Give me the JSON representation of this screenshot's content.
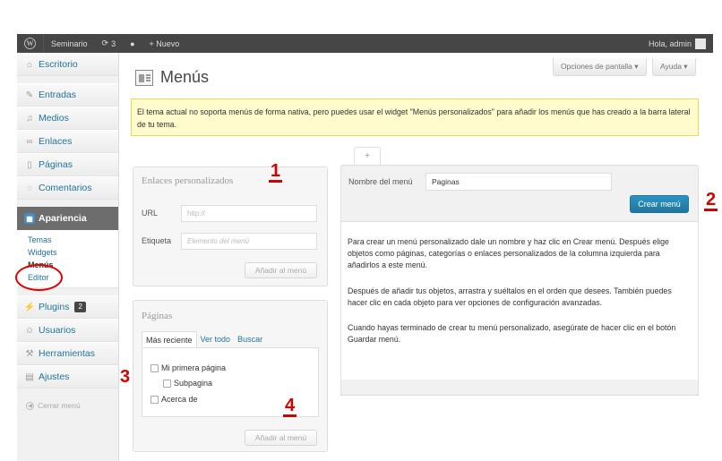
{
  "adminbar": {
    "logo_icon": "wordpress-logo-icon",
    "site_name": "Seminario",
    "updates_count": "3",
    "new_label": "+ Nuevo",
    "greeting": "Hola, admin"
  },
  "sidebar": {
    "items": [
      {
        "label": "Escritorio",
        "icon": "home-icon"
      },
      {
        "label": "Entradas",
        "icon": "pin-icon"
      },
      {
        "label": "Medios",
        "icon": "media-icon"
      },
      {
        "label": "Enlaces",
        "icon": "link-icon"
      },
      {
        "label": "Páginas",
        "icon": "page-icon"
      },
      {
        "label": "Comentarios",
        "icon": "comment-icon"
      },
      {
        "label": "Apariencia",
        "icon": "appearance-icon"
      },
      {
        "label": "Plugins",
        "icon": "plugin-icon",
        "badge": "2"
      },
      {
        "label": "Usuarios",
        "icon": "users-icon"
      },
      {
        "label": "Herramientas",
        "icon": "tools-icon"
      },
      {
        "label": "Ajustes",
        "icon": "settings-icon"
      }
    ],
    "submenu": [
      "Temas",
      "Widgets",
      "Menús",
      "Editor"
    ],
    "collapse_label": "Cerrar menú"
  },
  "header": {
    "title": "Menús",
    "screen_options": "Opciones de pantalla ▾",
    "help": "Ayuda ▾"
  },
  "notice": {
    "text": "El tema actual no soporta menús de forma nativa, pero puedes usar el widget \"Menús personalizados\" para añadir los menús que has creado a la barra lateral de tu tema."
  },
  "custom_links": {
    "title": "Enlaces personalizados",
    "url_label": "URL",
    "url_value": "http://",
    "label_label": "Etiqueta",
    "label_placeholder": "Elemento del menú",
    "add_button": "Añadir al menú"
  },
  "pages_box": {
    "title": "Páginas",
    "tabs": [
      "Más reciente",
      "Ver todo",
      "Buscar"
    ],
    "items": [
      "Mi primera página",
      "Subpagina",
      "Acerca de"
    ],
    "add_button": "Añadir al menú"
  },
  "menu_editor": {
    "add_tab": "+",
    "name_label": "Nombre del menú",
    "name_value": "Paginas",
    "create_button": "Crear menú",
    "instructions": [
      "Para crear un menú personalizado dale un nombre y haz clic en Crear menú. Después elige objetos como páginas, categorías o enlaces personalizados de la columna izquierda para añadirlos a este menú.",
      "Después de añadir tus objetos, arrastra y suéltalos en el orden que desees. También puedes hacer clic en cada objeto para ver opciones de configuración avanzadas.",
      "Cuando hayas terminado de crear tu menú personalizado, asegúrate de hacer clic en el botón Guardar menú."
    ]
  },
  "annotations": [
    "1",
    "2",
    "3",
    "4"
  ],
  "colors": {
    "accent": "#21759b",
    "annotation_red": "#d40000",
    "notice_bg": "#fffbcc"
  }
}
